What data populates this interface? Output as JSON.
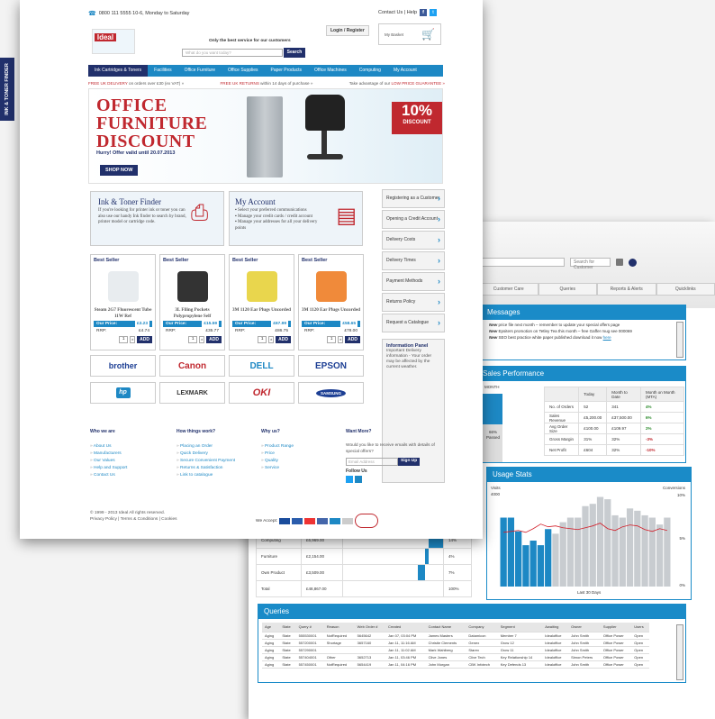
{
  "side_tab": "INK & TONER FINDER",
  "back": {
    "search_placeholder": "Search for Customer",
    "tabs": [
      "Customer Care",
      "Queries",
      "Reports & Alerts",
      "Quicklinks"
    ],
    "messages": {
      "title": "Messages",
      "lines": [
        {
          "lead": "New",
          "text": " price file next month – remember to update your special offers page"
        },
        {
          "lead": "New",
          "text": " Epsiters promotion on Tetley Tea this month – free Gaffer mug see 000069"
        },
        {
          "lead": "New",
          "text": " SEO best practice white paper published download it now "
        }
      ],
      "link": "here"
    },
    "sales": {
      "title": "Sales Performance",
      "month_label": "MONTH",
      "partial_pct": "66%",
      "partial_text": "Passed",
      "headers": [
        "",
        "Today",
        "Month to Date",
        "Month on Month (MTA)"
      ],
      "rows": [
        [
          "No. of Orders",
          "52",
          "341",
          "4%"
        ],
        [
          "Sales Revenue",
          "£5,200.00",
          "£37,500.00",
          "6%"
        ],
        [
          "Avg Order Size",
          "£100.00",
          "£109.97",
          "2%"
        ],
        [
          "Gross Margin",
          "31%",
          "32%",
          "-3%"
        ],
        [
          "Net Profit",
          "£604",
          "32%",
          "-10%"
        ]
      ]
    },
    "categories": [
      [
        "Computing",
        "£6,969.00",
        "14%"
      ],
      [
        "Furniture",
        "£2,154.00",
        "4%"
      ],
      [
        "Own Product",
        "£3,509.00",
        "7%"
      ],
      [
        "Total",
        "£48,867.00",
        "100%"
      ]
    ],
    "usage": {
      "title": "Usage Stats",
      "left_label": "Visits",
      "right_label": "Conversions",
      "y_left_top": "4000",
      "y_right_top": "10%",
      "y_right_mid": "5%",
      "y_right_bottom": "0%",
      "footer": "Last 30 Days"
    },
    "queries": {
      "title": "Queries",
      "headers": [
        "Age",
        "State",
        "Query #",
        "Reason",
        "Web Order #",
        "Created",
        "Contact Name",
        "Company",
        "Segment",
        "Awaiting",
        "Owner",
        "Supplier",
        "Users"
      ],
      "rows": [
        [
          "Aging",
          "State",
          "555530001",
          "NotRequired",
          "5645642",
          "Jan 07, 03:04 PM",
          "James Masters",
          "Datamicon",
          "Member 7",
          "Idealoffice",
          "John Smith",
          "Office Power",
          "Open"
        ],
        [
          "Aging",
          "State",
          "557200001",
          "Shortage",
          "3657160",
          "Jan 11, 11:16 AM",
          "Christie Clements",
          "Genex",
          "Grow 12",
          "Idealoffice",
          "John Smith",
          "Office Power",
          "Open"
        ],
        [
          "Aging",
          "State",
          "557290001",
          "",
          "",
          "Jan 11, 11:02 AM",
          "Mark Wahlberg",
          "Starex",
          "Grow 11",
          "Idealoffice",
          "John Smith",
          "Office Power",
          "Open"
        ],
        [
          "Aging",
          "State",
          "557404001",
          "Other",
          "3652713",
          "Jan 11, 03:46 PM",
          "Clive Jones",
          "Clive Tech",
          "Key Relationship 14",
          "Idealoffice",
          "Simon Peters",
          "Office Power",
          "Open"
        ],
        [
          "Aging",
          "State",
          "557450001",
          "NotRequired",
          "5654419",
          "Jan 11, 04:16 PM",
          "John Morgan",
          "CBK Infotech",
          "Key Defends 13",
          "Idealoffice",
          "John Smith",
          "Office Power",
          "Open"
        ]
      ]
    },
    "chart_data": {
      "type": "bar",
      "series": [
        {
          "name": "Visits",
          "values": [
            3000,
            3000,
            2400,
            1800,
            2000,
            1800,
            2500,
            2300,
            2800,
            3000,
            3000,
            3500,
            3600,
            3900,
            3800,
            3100,
            3000,
            3400,
            3300,
            3100,
            3000,
            2700,
            3000
          ]
        },
        {
          "name": "Conversions",
          "values": [
            5.9,
            6.0,
            6.1,
            5.9,
            6.3,
            6.8,
            6.5,
            6.6,
            6.4,
            6.3,
            6.2,
            6.4,
            6.6,
            6.9,
            6.3,
            6.1,
            6.5,
            6.7,
            6.6,
            6.2,
            6.0,
            6.3,
            6.1
          ]
        }
      ],
      "highlight_first": 7,
      "ylim_left": [
        0,
        4000
      ],
      "ylim_right": [
        0,
        10
      ]
    }
  },
  "front": {
    "phone": "0800 111 5555 10-6, Monday to Saturday",
    "top_right": "Contact Us | Help",
    "logo": "Ideal",
    "tagline": "Only the best service for our customers",
    "login": "Login / Register",
    "basket": "My Basket",
    "search_placeholder": "What do you want today?",
    "search_btn": "Search",
    "nav": [
      "Ink Cartridges & Toners",
      "Facilities",
      "Office Furniture",
      "Office Supplies",
      "Paper Products",
      "Office Machines",
      "Computing",
      "My Account"
    ],
    "promo": {
      "a_red": "FREE UK DELIVERY",
      "a_rest": " on orders over £30 (ex VAT) »",
      "b_red": "FREE UK RETURNS",
      "b_rest": " within 14 days of purchase »",
      "c_rest": "Take advantage of our ",
      "c_red": "LOW PRICE GUARANTEE »"
    },
    "hero": {
      "line1": "OFFICE",
      "line2": "FURNITURE",
      "line3": "DISCOUNT",
      "sub": "Hurry! Offer valid until 20.07.2013",
      "btn": "SHOP NOW",
      "badge_pct": "10%",
      "badge_txt": "DISCOUNT"
    },
    "ink_finder": {
      "title": "Ink & Toner Finder",
      "body": "If you're looking for printer ink or toner you can also use our handy Ink finder to search by brand, printer model or cartridge code."
    },
    "my_account": {
      "title": "My Account",
      "items": [
        "Select your preferred communications",
        "Manage your credit cards / credit account",
        "Manage your addresses for all your delivery points"
      ]
    },
    "side_links": [
      "Registering as a Customer",
      "Opening a Credit Account",
      "Delivery Costs",
      "Delivery Times",
      "Payment Methods",
      "Returns Policy",
      "Request a Catalogue"
    ],
    "info_panel": {
      "title": "Information Panel",
      "body": "Important Delivery information - Your order may be affected by the current weather."
    },
    "products": [
      {
        "badge": "Best Seller",
        "name": "Steam 2G7 Fluorescent Tube 11W Ref",
        "our": "£3.23",
        "rrp": "£4.74"
      },
      {
        "badge": "Best Seller",
        "name": "3L Filing Pockets Polypropylene Self",
        "our": "£15.59",
        "rrp": "£35.77"
      },
      {
        "badge": "Best Seller",
        "name": "3M 1120 Ear Plugs Uncorded",
        "our": "£67.99",
        "rrp": "£86.75"
      },
      {
        "badge": "Best Seller",
        "name": "3M 1120 Ear Plugs Uncorded",
        "our": "£58.65",
        "rrp": "£78.00"
      }
    ],
    "our_price_label": "Our Price:",
    "rrp_label": "RRP:",
    "qty": "1",
    "add_btn": "ADD",
    "brands": [
      "brother",
      "Canon",
      "DELL",
      "EPSON",
      "hp",
      "LEXMARK",
      "OKI",
      "SAMSUNG"
    ],
    "footer": {
      "col1": {
        "title": "Who we are",
        "links": [
          "About Us",
          "Manufacturers",
          "Our Values",
          "Help and Support",
          "Contact Us"
        ]
      },
      "col2": {
        "title": "How things work?",
        "links": [
          "Placing an Order",
          "Quick Delivery",
          "Secure Convenient Payment",
          "Returns & Satisfaction",
          "Link to catalogue"
        ]
      },
      "col3": {
        "title": "Why us?",
        "links": [
          "Product Range",
          "Price",
          "Quality",
          "Service"
        ]
      },
      "col4": {
        "title": "Want More?",
        "text": "Would you like to receive emails with details of special offers?",
        "placeholder": "Email Address",
        "btn": "Sign Up",
        "follow": "Follow Us"
      },
      "copyright": "© 1999 - 2013 Ideal All rights reserved.",
      "policy": "Privacy Policy | Terms & Conditions | Cookies",
      "we_accept": "We Accept:"
    },
    "colors": {
      "navy": "#21306b",
      "blue": "#1d88c4",
      "red": "#c0282f"
    }
  }
}
